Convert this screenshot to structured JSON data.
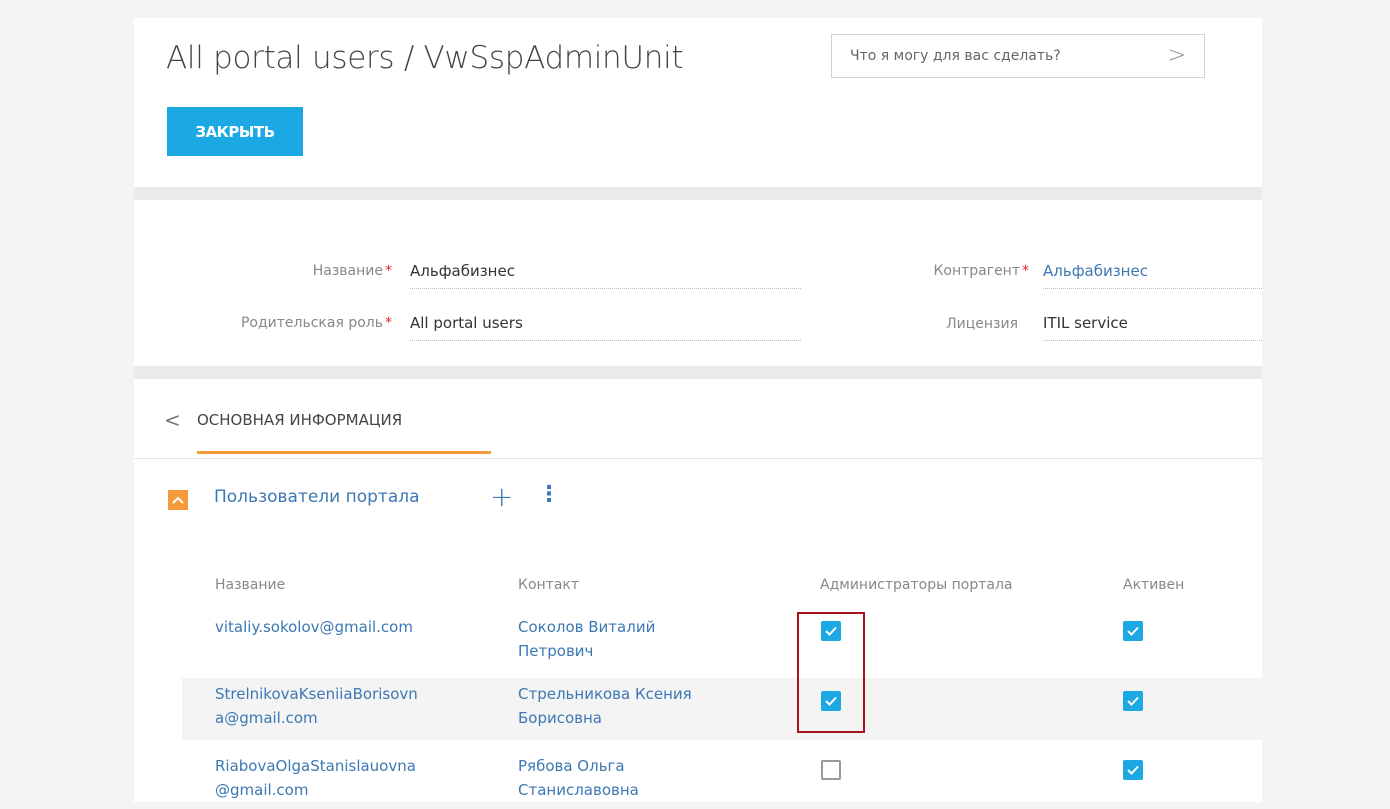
{
  "header": {
    "title": "All portal users / VwSspAdminUnit",
    "search_placeholder": "Что я могу для вас сделать?",
    "search_arrow": ">",
    "close_label": "ЗАКРЫТЬ"
  },
  "fields": {
    "name_label": "Название",
    "name_value": "Альфабизнес",
    "parent_role_label": "Родительская роль",
    "parent_role_value": "All portal users",
    "account_label": "Контрагент",
    "account_value": "Альфабизнес",
    "license_label": "Лицензия",
    "license_value": "ITIL service",
    "required_mark": "*"
  },
  "tabs": {
    "back": "<",
    "main_label": "ОСНОВНАЯ ИНФОРМАЦИЯ"
  },
  "detail": {
    "title": "Пользователи портала",
    "add_icon": "+",
    "more_icon": "⋮",
    "columns": [
      "Название",
      "Контакт",
      "Администраторы портала",
      "Активен"
    ],
    "rows": [
      {
        "name_line1": "vitaliy.sokolov@gmail.com",
        "name_line2": "",
        "contact_line1": "Соколов Виталий",
        "contact_line2": "Петрович",
        "portal_admin": true,
        "active": true
      },
      {
        "name_line1": "StrelnikovaKseniiaBorisovn",
        "name_line2": "a@gmail.com",
        "contact_line1": "Стрельникова Ксения",
        "contact_line2": "Борисовна",
        "portal_admin": true,
        "active": true
      },
      {
        "name_line1": "RiabovaOlgaStanislauovna",
        "name_line2": "@gmail.com",
        "contact_line1": "Рябова Ольга",
        "contact_line2": "Станиславовна",
        "portal_admin": false,
        "active": true
      }
    ]
  },
  "colors": {
    "accent": "#1ba8e3",
    "link": "#3c78b4",
    "tab_underline": "#f59a3a",
    "highlight": "#a8121b",
    "required": "#e3262a"
  }
}
